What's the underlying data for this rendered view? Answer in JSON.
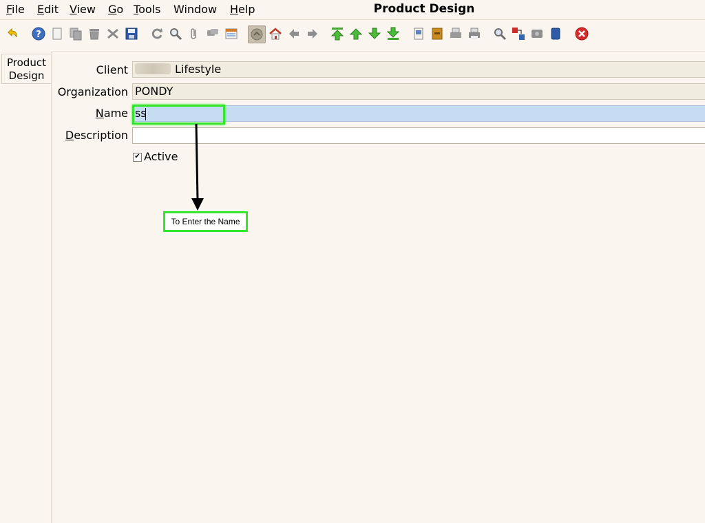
{
  "menu": {
    "items": [
      {
        "label": "File",
        "ul": "F",
        "rest": "ile"
      },
      {
        "label": "Edit",
        "ul": "E",
        "rest": "dit"
      },
      {
        "label": "View",
        "ul": "V",
        "rest": "iew"
      },
      {
        "label": "Go",
        "ul": "G",
        "rest": "o"
      },
      {
        "label": "Tools",
        "ul": "T",
        "rest": "ools"
      },
      {
        "label": "Window",
        "ul": "",
        "rest": "Window"
      },
      {
        "label": "Help",
        "ul": "H",
        "rest": "elp"
      }
    ]
  },
  "window": {
    "title": "Product Design"
  },
  "toolbar": {
    "icons": [
      "undo-icon",
      "help-icon",
      "new-record-icon",
      "copy-record-icon",
      "delete-icon",
      "delete-selection-icon",
      "save-icon",
      "refresh-icon",
      "find-icon",
      "attachment-icon",
      "chat-icon",
      "grid-toggle-icon",
      "history-icon",
      "home-icon",
      "back-icon",
      "forward-icon",
      "first-record-icon",
      "previous-record-icon",
      "next-record-icon",
      "last-record-icon",
      "report-icon",
      "archive-icon",
      "print-preview-icon",
      "print-icon",
      "zoom-across-icon",
      "workflow-icon",
      "request-icon",
      "product-info-icon",
      "close-window-icon"
    ]
  },
  "tab": {
    "line1": "Product",
    "line2": "Design"
  },
  "form": {
    "client": {
      "label": "Client",
      "value": "Lifestyle"
    },
    "organization": {
      "label": "Organization",
      "value": "PONDY"
    },
    "name": {
      "label_ul": "N",
      "label_rest": "ame",
      "value": "ss"
    },
    "description": {
      "label_ul": "D",
      "label_rest": "escription",
      "value": ""
    },
    "active": {
      "label": "Active",
      "checked": true
    }
  },
  "annotation": {
    "text": "To Enter the Name"
  },
  "colors": {
    "highlight": "#33e52b",
    "focus_field": "#c6dcf2",
    "background": "#faf6ef"
  }
}
